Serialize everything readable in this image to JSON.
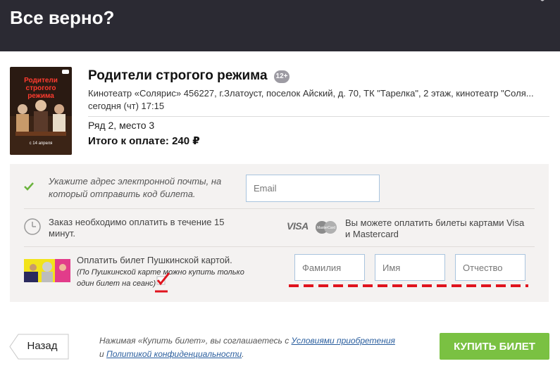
{
  "dialog": {
    "title": "Все верно?"
  },
  "movie": {
    "title": "Родители строгого режима",
    "age_rating": "12+",
    "address": "Кинотеатр «Солярис» 456227, г.Златоуст, поселок Айский, д. 70, ТК \"Тарелка\", 2 этаж, кинотеатр \"Соля...",
    "showtime": "сегодня (чт) 17:15",
    "seat": "Ряд 2, место 3",
    "total": "Итого к оплате: 240 ₽",
    "poster": {
      "title_line1": "Родители",
      "title_line2": "строгого",
      "title_line3": "режима",
      "date_text": "с 14 апреля"
    }
  },
  "form": {
    "email_hint": "Укажите адрес электронной почты, на который отправить код билета.",
    "email_placeholder": "Email",
    "pay_time": "Заказ необходимо оплатить в течение 15 минут.",
    "visa": "VISA",
    "mastercard": "MasterCard",
    "cards_text": "Вы можете оплатить билеты картами Visa и Mastercard",
    "pushkin_main": "Оплатить билет Пушкинской картой.",
    "pushkin_note": "(По Пушкинской карте можно купить только один билет на сеанс)",
    "pushkin_checked": true,
    "last_name_placeholder": "Фамилия",
    "first_name_placeholder": "Имя",
    "middle_name_placeholder": "Отчество"
  },
  "footer": {
    "back_label": "Назад",
    "agree_prefix": "Нажимая «Купить билет», вы соглашаетесь с ",
    "terms_link": "Условиями приобретения",
    "agree_and": "и ",
    "privacy_link": "Политикой конфиденциальности",
    "agree_suffix": ".",
    "buy_label": "КУПИТЬ БИЛЕТ"
  },
  "colors": {
    "header_bg": "#2b2a33",
    "buy_button": "#7ac142",
    "link": "#2a5e9e",
    "annotation_red": "#e0141e",
    "check_green": "#6bb33d"
  }
}
